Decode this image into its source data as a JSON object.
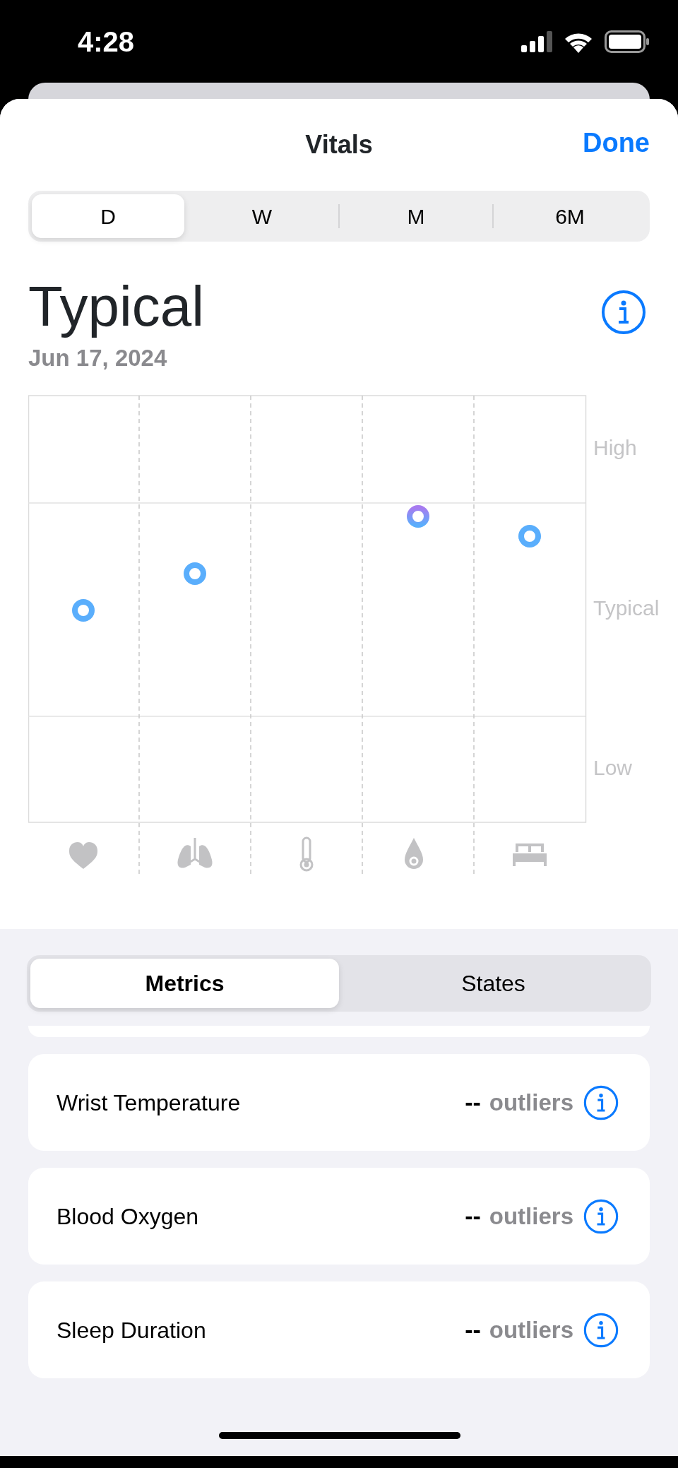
{
  "status_bar": {
    "time": "4:28"
  },
  "header": {
    "title": "Vitals",
    "done": "Done"
  },
  "range_tabs": [
    {
      "label": "D",
      "selected": true
    },
    {
      "label": "W",
      "selected": false
    },
    {
      "label": "M",
      "selected": false
    },
    {
      "label": "6M",
      "selected": false
    }
  ],
  "summary": {
    "title": "Typical",
    "date": "Jun 17, 2024"
  },
  "chart": {
    "band_labels": [
      "High",
      "Typical",
      "Low"
    ]
  },
  "view_tabs": [
    {
      "label": "Metrics",
      "selected": true
    },
    {
      "label": "States",
      "selected": false
    }
  ],
  "metrics": [
    {
      "label": "Wrist Temperature",
      "value": "--",
      "unit": "outliers"
    },
    {
      "label": "Blood Oxygen",
      "value": "--",
      "unit": "outliers"
    },
    {
      "label": "Sleep Duration",
      "value": "--",
      "unit": "outliers"
    }
  ]
}
